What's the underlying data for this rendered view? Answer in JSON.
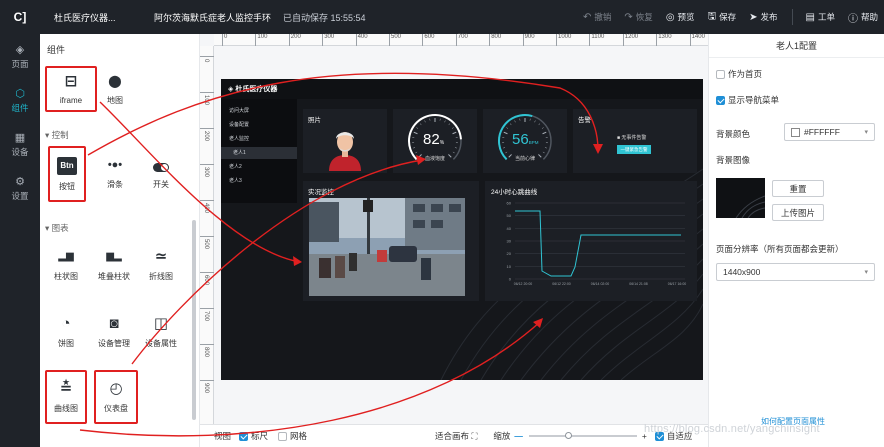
{
  "topbar": {
    "logo": "C]",
    "project": "杜氏医疗仪器...",
    "title": "阿尔茨海默氏症老人监控手环",
    "autosave": "已自动保存 15:55:54",
    "actions": [
      {
        "icon": "undo-icon",
        "glyph": "↶",
        "label": "撤销",
        "disabled": true
      },
      {
        "icon": "redo-icon",
        "glyph": "↷",
        "label": "恢复",
        "disabled": true
      },
      {
        "icon": "eye-icon",
        "glyph": "◎",
        "label": "预览",
        "disabled": false
      },
      {
        "icon": "save-icon",
        "glyph": "🖫",
        "label": "保存",
        "disabled": false
      },
      {
        "icon": "send-icon",
        "glyph": "➤",
        "label": "发布",
        "disabled": false
      },
      {
        "icon": "workorder-icon",
        "glyph": "▤",
        "label": "工单",
        "disabled": false
      },
      {
        "icon": "help-icon",
        "glyph": "ⓘ",
        "label": "帮助",
        "disabled": false
      }
    ]
  },
  "leftnav": [
    {
      "icon": "layers-icon",
      "glyph": "◈",
      "label": "页面",
      "active": false
    },
    {
      "icon": "cube-icon",
      "glyph": "⬡",
      "label": "组件",
      "active": true
    },
    {
      "icon": "device-icon",
      "glyph": "▦",
      "label": "设备",
      "active": false
    },
    {
      "icon": "settings-icon",
      "glyph": "⚙",
      "label": "设置",
      "active": false
    }
  ],
  "components": {
    "title": "组件",
    "sections": {
      "control": "控制",
      "chart": "图表"
    },
    "items": {
      "iframe": {
        "label": "iframe",
        "glyph": "⊟"
      },
      "map": {
        "label": "地图",
        "glyph": "⬤"
      },
      "button": {
        "label": "按钮",
        "glyph": "Btn"
      },
      "slider": {
        "label": "滑条",
        "glyph": "•●•"
      },
      "switch": {
        "label": "开关",
        "glyph": "●"
      },
      "bar": {
        "label": "柱状图",
        "glyph": "▂▆"
      },
      "stacked": {
        "label": "堆叠柱状",
        "glyph": "▆▂"
      },
      "line": {
        "label": "折线图",
        "glyph": "≃"
      },
      "pie": {
        "label": "饼图",
        "glyph": "◔"
      },
      "device_mgmt": {
        "label": "设备管理",
        "glyph": "◙"
      },
      "device_attr": {
        "label": "设备属性",
        "glyph": "◫"
      },
      "curve": {
        "label": "曲线图",
        "glyph": "≛"
      },
      "gauge": {
        "label": "仪表盘",
        "glyph": "◴"
      }
    }
  },
  "ruler": {
    "top": [
      "0",
      "100",
      "200",
      "300",
      "400",
      "500",
      "600",
      "700",
      "800",
      "900",
      "1000",
      "1100",
      "1200",
      "1300",
      "1400"
    ],
    "left": [
      "0",
      "100",
      "200",
      "300",
      "400",
      "500",
      "600",
      "700",
      "800",
      "900"
    ]
  },
  "dashboard": {
    "brand": "杜氏医疗仪器",
    "menu": [
      {
        "label": "访问大屏",
        "active": false
      },
      {
        "label": "设备配置",
        "active": false
      },
      {
        "label": "老人监控",
        "active": false
      },
      {
        "label": "老人1",
        "active": true
      },
      {
        "label": "老人2",
        "active": false
      },
      {
        "label": "老人3",
        "active": false
      }
    ],
    "photo_title": "照片",
    "gauge1": {
      "value": "82",
      "unit": "%",
      "label": "血液饱度",
      "fraction": 0.82,
      "color": "#ffffff"
    },
    "gauge2": {
      "value": "56",
      "unit": "BPM",
      "label": "当前心律",
      "fraction": 0.56,
      "color": "#30c4d3"
    },
    "alert": {
      "title": "告警",
      "text": "■ 无事件告警",
      "button": "一键紧急告警"
    },
    "monitor_title": "实况监控",
    "chart": {
      "title": "24小时心跳曲线",
      "yticks": [
        "60",
        "50",
        "40",
        "30",
        "20",
        "10",
        "0"
      ],
      "xticks": [
        "06/12 20:00",
        "06/12 22:00",
        "06/14 02:00",
        "06/14 21:08",
        "06/17 16:00"
      ]
    }
  },
  "bottombar": {
    "view": "视图",
    "ruler": "标尺",
    "grid": "网格",
    "fit": "适合画布",
    "zoom": "缩放",
    "minus": "—",
    "plus": "+",
    "auto": "自适应",
    "ruler_on": true,
    "grid_on": false,
    "auto_on": true
  },
  "props": {
    "title": "老人1配置",
    "homepage": "作为首页",
    "homepage_on": false,
    "shownav": "显示导航菜单",
    "shownav_on": true,
    "bgcolor_label": "背景颜色",
    "bgcolor_value": "#FFFFFF",
    "bgimage_label": "背景图像",
    "reset": "重置",
    "upload": "上传图片",
    "resolution_label": "页面分辨率（所有页面都会更新）",
    "resolution_value": "1440x900",
    "link": "如何配置页面属性"
  },
  "watermark": "https://blog.csdn.net/yangchinsight",
  "colors": {
    "accent": "#1fb3c8",
    "annotation": "#e02020",
    "nav_bg": "#1f2329",
    "stage_bg": "#15171b"
  }
}
